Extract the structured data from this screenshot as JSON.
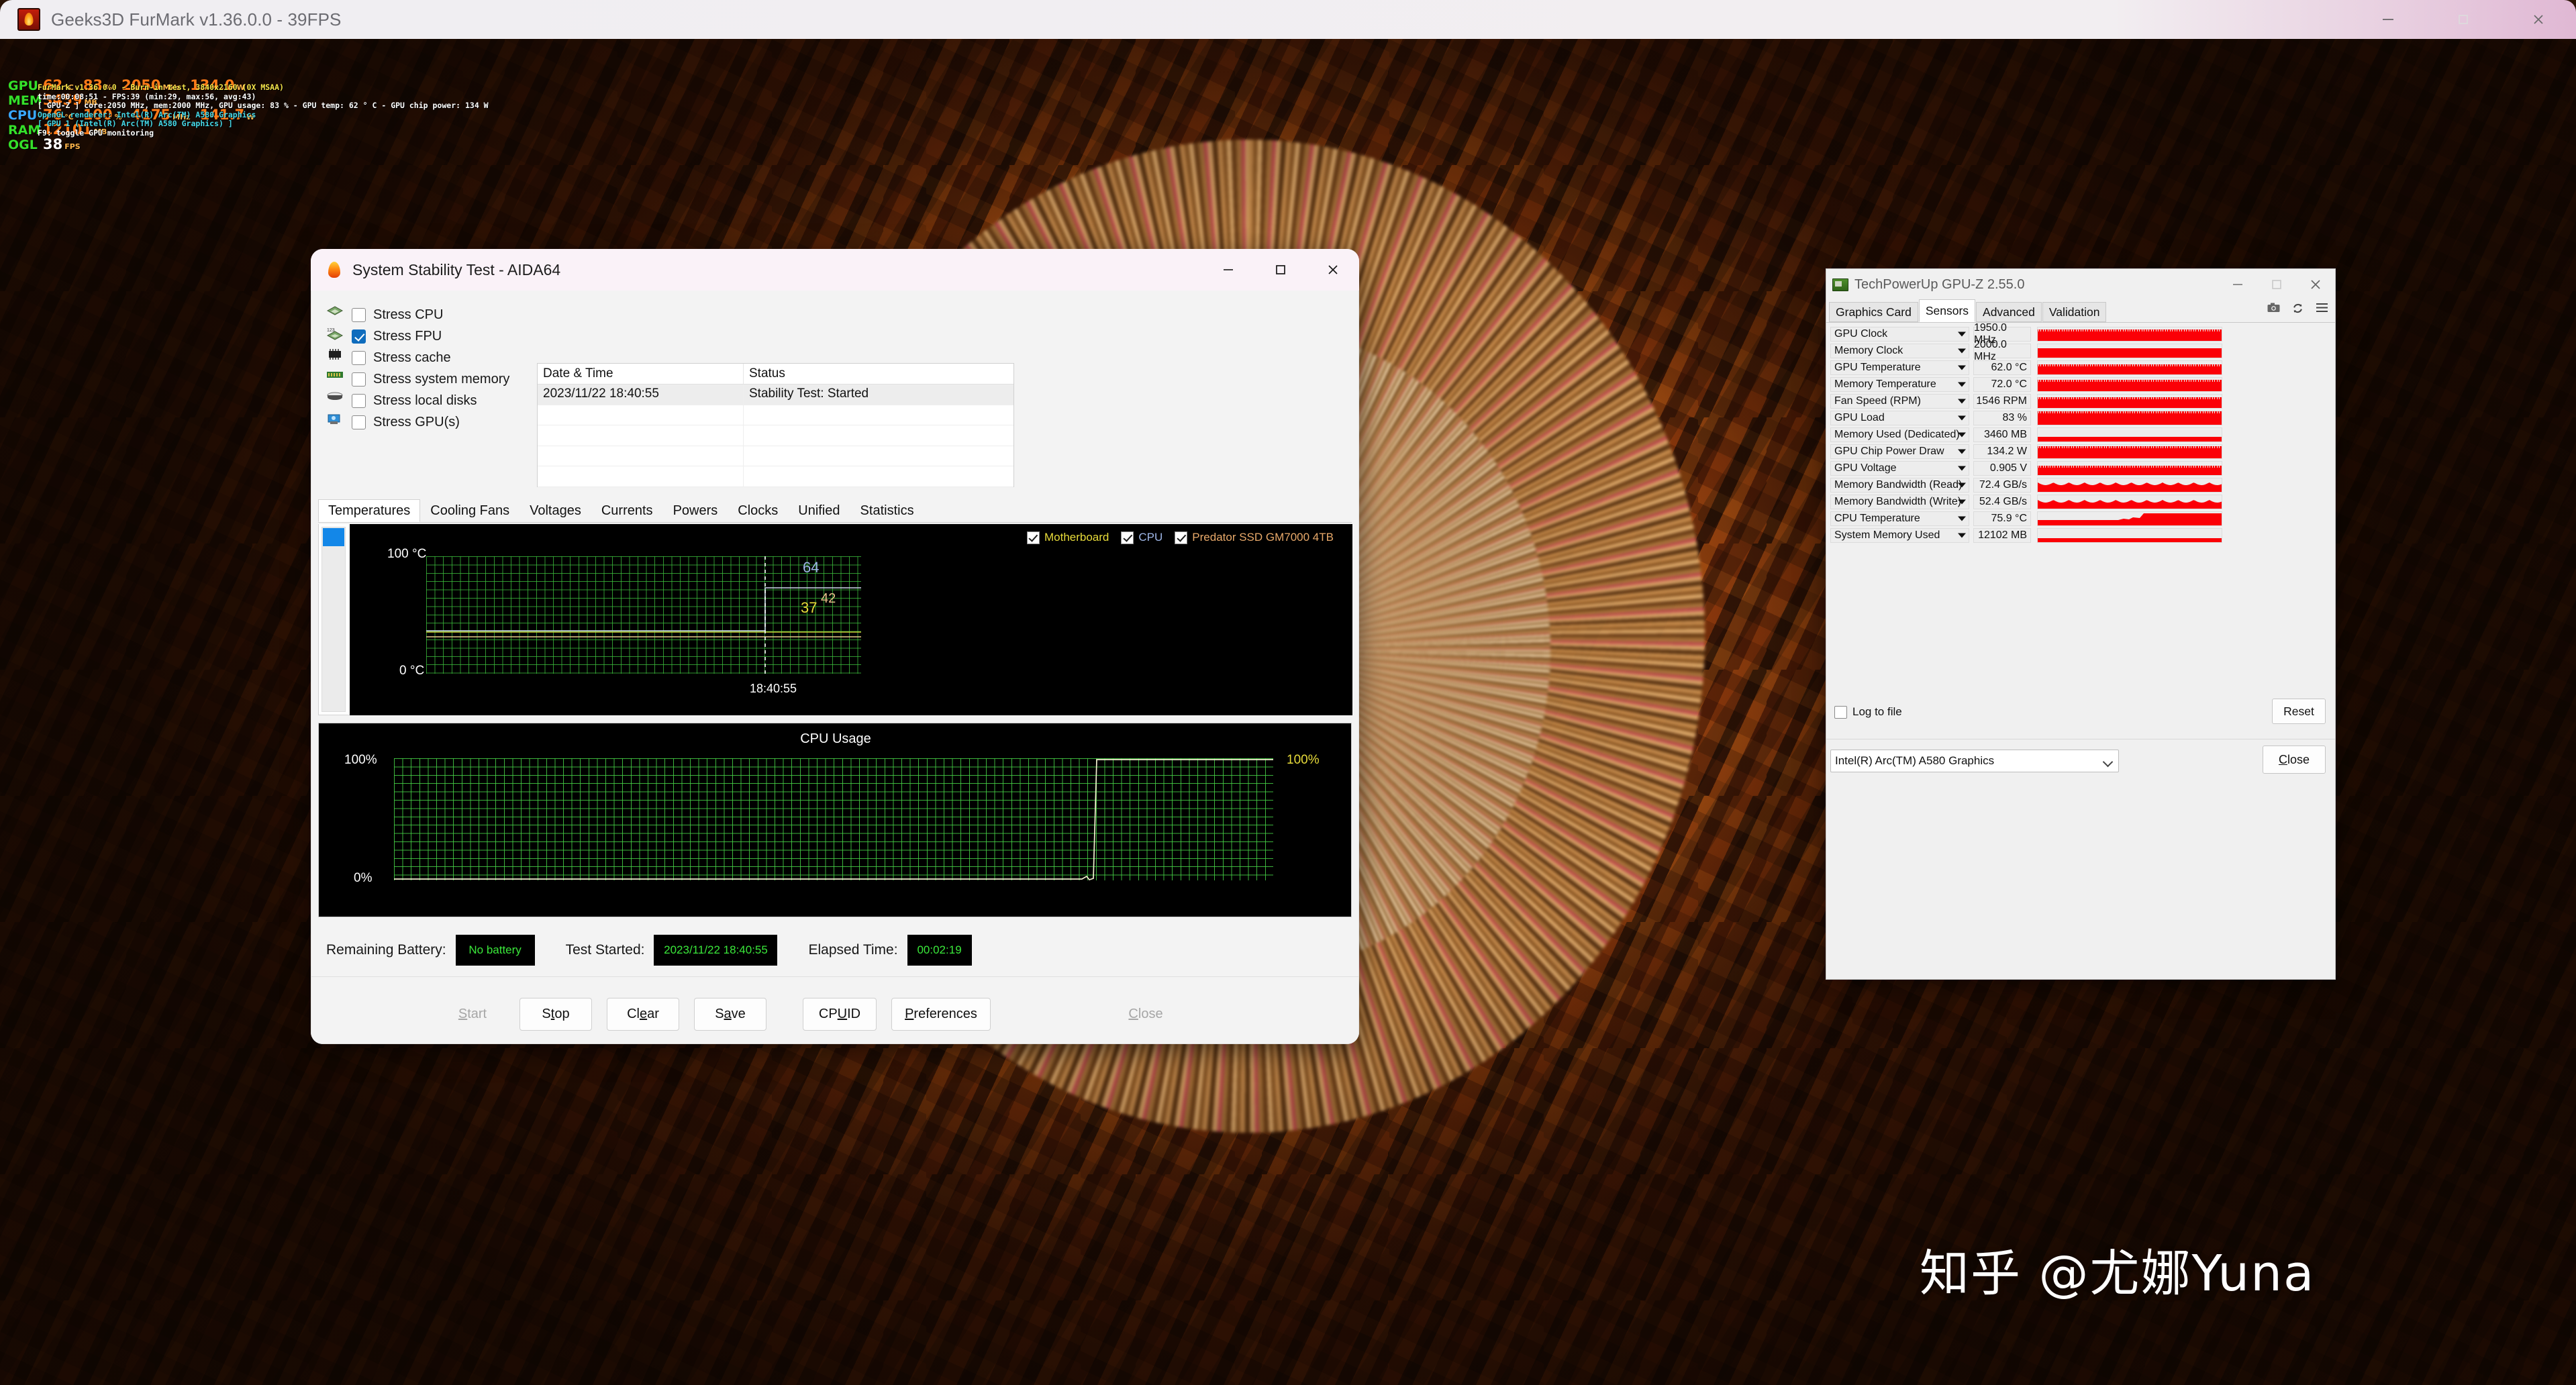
{
  "furmark": {
    "title": "Geeks3D FurMark v1.36.0.0 - 39FPS",
    "window_buttons": {
      "minimize": "minimize-icon",
      "maximize": "maximize-icon",
      "close": "close-icon"
    },
    "osd": {
      "hud": [
        {
          "label": "GPU",
          "items": [
            {
              "value": "62",
              "unit": "°C"
            },
            {
              "value": "83",
              "unit": "%"
            },
            {
              "value": "2050",
              "unit": "MHz"
            },
            {
              "value": "134.0",
              "unit": "W"
            }
          ]
        },
        {
          "label": "MEM",
          "items": [
            {
              "value": "3459",
              "unit": "MB"
            }
          ]
        },
        {
          "label": "CPU",
          "items": [
            {
              "value": "76",
              "unit": "°C"
            },
            {
              "value": "100",
              "unit": "%"
            },
            {
              "value": "4175",
              "unit": "MHz"
            },
            {
              "value": "141.7",
              "unit": "W"
            }
          ]
        },
        {
          "label": "RAM",
          "items": [
            {
              "value": "12101",
              "unit": "MB"
            }
          ]
        },
        {
          "label": "OGL",
          "items": [
            {
              "value": "38",
              "unit": "FPS"
            }
          ]
        }
      ],
      "lines": [
        "FurMark v1.36.0.0 - Burn-in test, 3840x2160 (0X MSAA)",
        "time:00:08:51 - FPS:39 (min:29, max:56, avg:43)",
        "[ GPU-Z ] core:2050 MHz, mem:2000 MHz, GPU usage: 83 % - GPU temp: 62 ° C - GPU chip power: 134 W",
        "OpenGL renderer: Intel(R) Arc(TM) A580 Graphics",
        "[ GPU 1 (Intel(R) Arc(TM) A580 Graphics) ]",
        "F9: toggle GPU monitoring"
      ]
    }
  },
  "aida64": {
    "title": "System Stability Test - AIDA64",
    "window_buttons": {
      "minimize": "minimize-icon",
      "maximize": "maximize-icon",
      "close": "close-icon"
    },
    "stress_options": [
      {
        "label": "Stress CPU",
        "checked": false,
        "icon": "cpu-chip-icon"
      },
      {
        "label": "Stress FPU",
        "checked": true,
        "icon": "fpu-chip-icon"
      },
      {
        "label": "Stress cache",
        "checked": false,
        "icon": "cache-chip-icon"
      },
      {
        "label": "Stress system memory",
        "checked": false,
        "icon": "memory-dimm-icon"
      },
      {
        "label": "Stress local disks",
        "checked": false,
        "icon": "hard-disk-icon"
      },
      {
        "label": "Stress GPU(s)",
        "checked": false,
        "icon": "gpu-card-icon"
      }
    ],
    "log": {
      "columns": [
        "Date & Time",
        "Status"
      ],
      "rows": [
        {
          "datetime": "2023/11/22 18:40:55",
          "status": "Stability Test: Started"
        }
      ]
    },
    "tabs": [
      {
        "label": "Temperatures",
        "active": true
      },
      {
        "label": "Cooling Fans",
        "active": false
      },
      {
        "label": "Voltages",
        "active": false
      },
      {
        "label": "Currents",
        "active": false
      },
      {
        "label": "Powers",
        "active": false
      },
      {
        "label": "Clocks",
        "active": false
      },
      {
        "label": "Unified",
        "active": false
      },
      {
        "label": "Statistics",
        "active": false
      }
    ],
    "temp_chart": {
      "legend": [
        {
          "label": "Motherboard",
          "checked": true,
          "color": "#e8dc3a"
        },
        {
          "label": "CPU",
          "checked": true,
          "color": "#9fb7e8"
        },
        {
          "label": "Predator SSD GM7000 4TB",
          "checked": true,
          "color": "#e8a96a"
        }
      ],
      "y_top": "100 °C",
      "y_bottom": "0 °C",
      "x_label": "18:40:55",
      "values": [
        {
          "label": "64",
          "color": "#9fb7e8"
        },
        {
          "label": "37",
          "color": "#e8dc3a"
        },
        {
          "label": "42",
          "color": "#e8a96a"
        }
      ]
    },
    "cpu_chart": {
      "title": "CPU Usage",
      "y_top": "100%",
      "y_bottom": "0%",
      "current": "100%"
    },
    "status": {
      "battery_label": "Remaining Battery:",
      "battery_value": "No battery",
      "started_label": "Test Started:",
      "started_value": "2023/11/22 18:40:55",
      "elapsed_label": "Elapsed Time:",
      "elapsed_value": "00:02:19"
    },
    "buttons": [
      {
        "label": "Start",
        "accel": "S",
        "disabled": true
      },
      {
        "label": "Stop",
        "accel": "t",
        "disabled": false
      },
      {
        "label": "Clear",
        "accel": "e",
        "disabled": false
      },
      {
        "label": "Save",
        "accel": "a",
        "disabled": false
      },
      {
        "label": "CPUID",
        "accel": "U",
        "disabled": false
      },
      {
        "label": "Preferences",
        "accel": "P",
        "disabled": false
      },
      {
        "label": "Close",
        "accel": "C",
        "disabled": true
      }
    ]
  },
  "gpuz": {
    "title": "TechPowerUp GPU-Z 2.55.0",
    "window_buttons": {
      "minimize": "minimize-icon",
      "maximize": "maximize-icon",
      "close": "close-icon"
    },
    "tabs": [
      {
        "label": "Graphics Card",
        "active": false
      },
      {
        "label": "Sensors",
        "active": true
      },
      {
        "label": "Advanced",
        "active": false
      },
      {
        "label": "Validation",
        "active": false
      }
    ],
    "tab_icons": [
      "camera-icon",
      "refresh-icon",
      "hamburger-menu-icon"
    ],
    "sensors": [
      {
        "name": "GPU Clock",
        "value": "1950.0 MHz",
        "fill": 0.72,
        "style": "noisy"
      },
      {
        "name": "Memory Clock",
        "value": "2000.0 MHz",
        "fill": 0.7,
        "style": "flat"
      },
      {
        "name": "GPU Temperature",
        "value": "62.0 °C",
        "fill": 0.62,
        "style": "noisy"
      },
      {
        "name": "Memory Temperature",
        "value": "72.0 °C",
        "fill": 0.72,
        "style": "noisy"
      },
      {
        "name": "Fan Speed (RPM)",
        "value": "1546 RPM",
        "fill": 0.66,
        "style": "noisy"
      },
      {
        "name": "GPU Load",
        "value": "83 %",
        "fill": 0.83,
        "style": "noisy"
      },
      {
        "name": "Memory Used (Dedicated)",
        "value": "3460 MB",
        "fill": 0.34,
        "style": "flat"
      },
      {
        "name": "GPU Chip Power Draw",
        "value": "134.2 W",
        "fill": 0.76,
        "style": "noisy"
      },
      {
        "name": "GPU Voltage",
        "value": "0.905 V",
        "fill": 0.56,
        "style": "noisy"
      },
      {
        "name": "Memory Bandwidth (Read)",
        "value": "72.4 GB/s",
        "fill": 0.7,
        "style": "wave"
      },
      {
        "name": "Memory Bandwidth (Write)",
        "value": "52.4 GB/s",
        "fill": 0.66,
        "style": "wave"
      },
      {
        "name": "CPU Temperature",
        "value": "75.9 °C",
        "fill": 0.4,
        "style": "step"
      },
      {
        "name": "System Memory Used",
        "value": "12102 MB",
        "fill": 0.3,
        "style": "flat"
      }
    ],
    "log_to_file": {
      "label": "Log to file",
      "checked": false
    },
    "reset_label": "Reset",
    "gpu_selected": "Intel(R) Arc(TM) A580 Graphics",
    "close_label": "Close",
    "accent_color": "#fb0007"
  },
  "watermark": {
    "text": "知乎 @尤娜Yuna"
  }
}
